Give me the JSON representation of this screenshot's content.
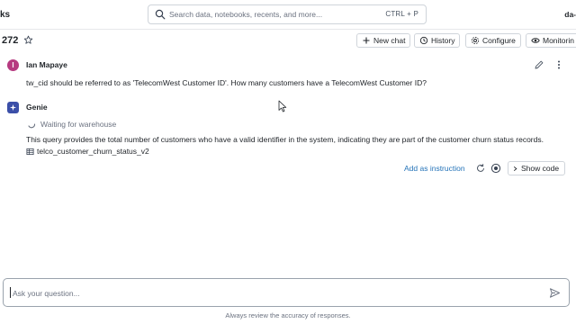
{
  "topbar": {
    "brand_fragment": "ks",
    "search_placeholder": "Search data, notebooks, recents, and more...",
    "search_shortcut": "CTRL + P",
    "user_fragment": "da-"
  },
  "header": {
    "room_id": "272",
    "buttons": {
      "new_chat": "New chat",
      "history": "History",
      "configure": "Configure",
      "monitoring": "Monitorin"
    }
  },
  "conversation": {
    "user_message": {
      "avatar_initial": "I",
      "avatar_color": "#b63a80",
      "author": "Ian Mapaye",
      "text": "tw_cid should be referred to as 'TelecomWest Customer ID'. How many customers have a TelecomWest Customer ID?"
    },
    "genie_message": {
      "avatar_color": "#3b4fa8",
      "author": "Genie",
      "status": "Waiting for warehouse",
      "description": "This query provides the total number of customers who have a valid identifier in the system, indicating they are part of the customer churn status records.",
      "table_name": "telco_customer_churn_status_v2",
      "add_instruction": "Add as instruction",
      "show_code": "Show code"
    }
  },
  "composer": {
    "placeholder": "Ask your question...",
    "footer_note": "Always review the accuracy of responses."
  },
  "colors": {
    "link": "#2473b8",
    "border": "#d0d5db"
  }
}
